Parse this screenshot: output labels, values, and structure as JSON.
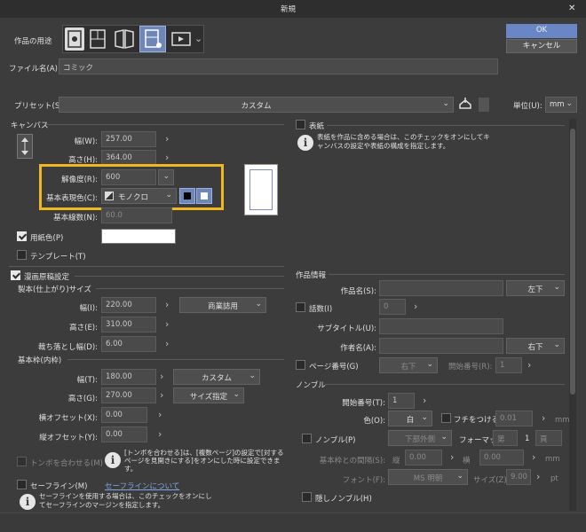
{
  "window": {
    "title": "新規",
    "close": "✕"
  },
  "buttons": {
    "ok": "OK",
    "cancel": "キャンセル"
  },
  "usage": {
    "label": "作品の用途"
  },
  "filename": {
    "label": "ファイル名(A):",
    "value": "コミック"
  },
  "preset": {
    "label": "プリセット(S):",
    "value": "カスタム",
    "unit_label": "単位(U):",
    "unit_value": "mm"
  },
  "canvas": {
    "section": "キャンバス",
    "width_label": "幅(W):",
    "width": "257.00",
    "height_label": "高さ(H):",
    "height": "364.00",
    "resolution_label": "解像度(R):",
    "resolution": "600",
    "color_label": "基本表現色(C):",
    "color_value": "モノクロ",
    "line_label": "基本線数(N):",
    "line_value": "60.0",
    "paper_label": "用紙色(P)",
    "template_label": "テンプレート(T)"
  },
  "manga": {
    "section": "漫画原稿設定",
    "bleed_section": "製本(仕上がり)サイズ",
    "b_width_label": "幅(I):",
    "b_width": "220.00",
    "b_preset": "商業誌用",
    "b_height_label": "高さ(E):",
    "b_height": "310.00",
    "bleed_label": "裁ち落とし幅(D):",
    "bleed": "6.00",
    "frame_section": "基本枠(内枠)",
    "f_width_label": "幅(T):",
    "f_width": "180.00",
    "f_preset": "カスタム",
    "f_height_label": "高さ(G):",
    "f_height": "270.00",
    "f_size": "サイズ指定",
    "offx_label": "横オフセット(X):",
    "offx": "0.00",
    "offy_label": "縦オフセット(Y):",
    "offy": "0.00",
    "tombo_label": "トンボを合わせる(M)",
    "tombo_info": "[トンボを合わせる]は、[複数ページ]の設定で[対するページを見開きにする]をオンにした時に設定できます。",
    "safe_label": "セーフライン(M)",
    "safe_link": "セーフラインについて",
    "safe_info": "セーフラインを使用する場合は、このチェックをオンにしてセーフラインのマージンを指定します。"
  },
  "cover": {
    "label": "表紙",
    "info": "表紙を作品に含める場合は、このチェックをオンにしてキャンバスの設定や表紙の構成を指定します。"
  },
  "work": {
    "section": "作品情報",
    "name_label": "作品名(S):",
    "name_pos": "左下",
    "episode_label": "話数(I)",
    "episode_value": "0",
    "subtitle_label": "サブタイトル(U):",
    "author_label": "作者名(A):",
    "author_pos": "右下",
    "page_label": "ページ番号(G)",
    "page_pos": "右下",
    "start_label": "開始番号(R):",
    "start_value": "1"
  },
  "nombre": {
    "section": "ノンブル",
    "start_label": "開始番号(T):",
    "start_value": "1",
    "color_label": "色(O):",
    "color_value": "白",
    "border_label": "フチをつける(E):",
    "border_value": "0.01",
    "border_unit": "mm",
    "nombre_label": "ノンブル(P)",
    "nombre_pos": "下部外側",
    "format_label": "フォーマット:",
    "format_pre": "第",
    "format_num": "1",
    "format_post": "頁",
    "gap_label": "基本枠との間隔(S):",
    "gap_v_label": "縦",
    "gap_v": "0.00",
    "gap_h_label": "横",
    "gap_h": "0.00",
    "gap_unit": "mm",
    "font_label": "フォント(F):",
    "font_value": "MS 明朝",
    "size_label": "サイズ(Z):",
    "size_value": "9.00",
    "size_unit": "pt",
    "hidden_label": "隠しノンブル(H)"
  }
}
